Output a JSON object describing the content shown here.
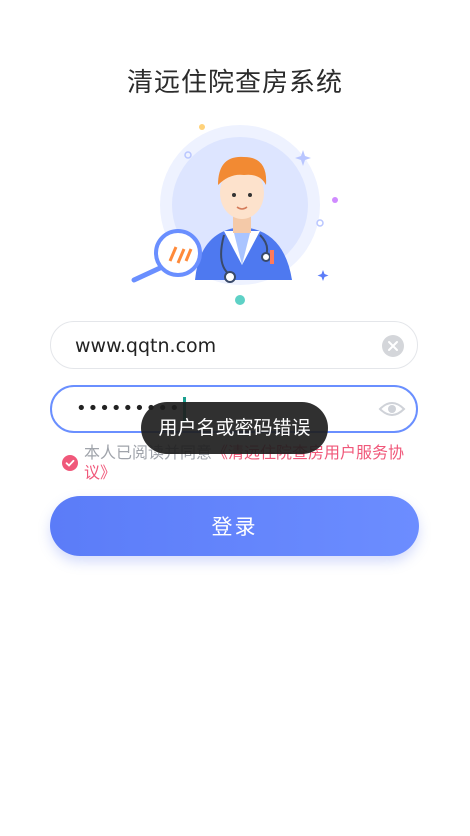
{
  "app": {
    "title": "清远住院查房系统"
  },
  "form": {
    "username_value": "www.qqtn.com",
    "password_value": "•••••••••",
    "agreement_prefix": "本人已阅读并同意",
    "agreement_link": "《清远住院查房用户服务协议》",
    "login_label": "登录"
  },
  "toast": {
    "message": "用户名或密码错误"
  },
  "icons": {
    "clear": "clear-icon",
    "eye": "eye-icon",
    "check": "check-icon",
    "illustration": "doctor-illustration"
  },
  "colors": {
    "accent": "#5b7cf8",
    "link": "#f0587a",
    "cursor": "#1b9f8f"
  }
}
